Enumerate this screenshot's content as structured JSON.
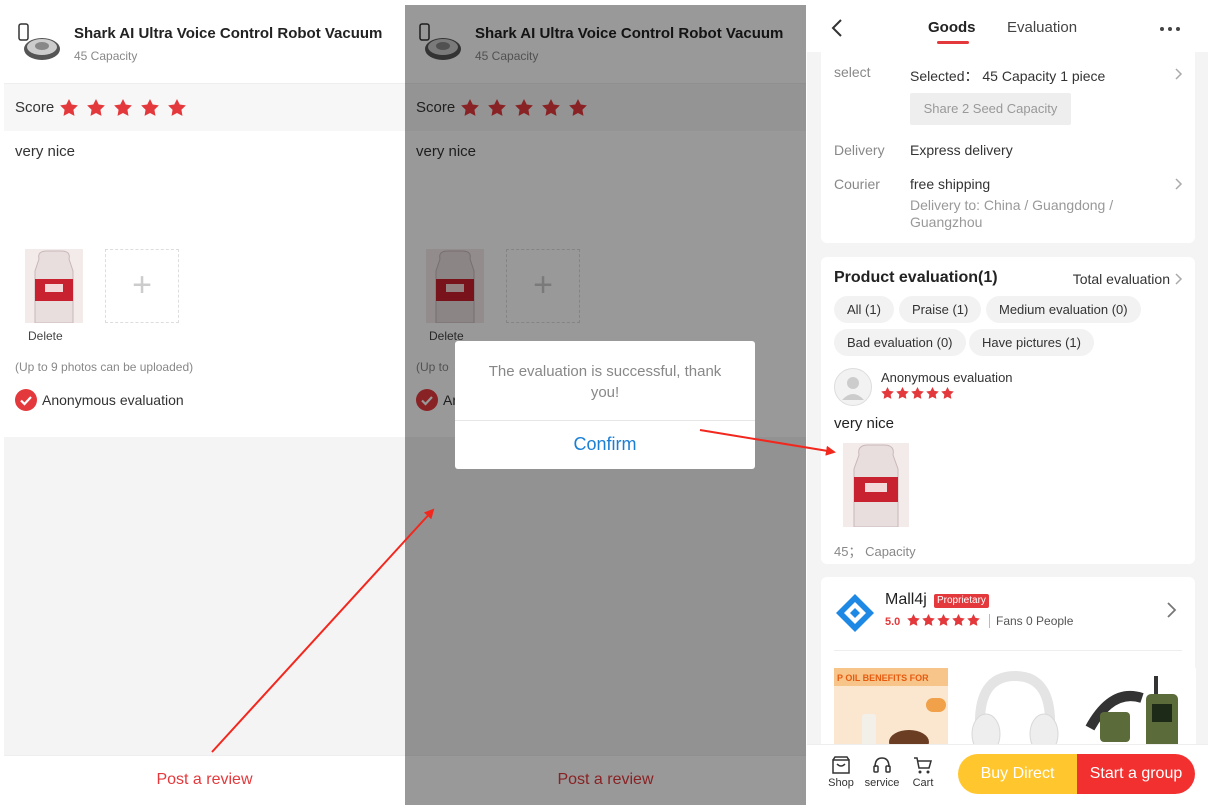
{
  "review": {
    "product_name": "Shark AI Ultra Voice Control Robot Vacuum",
    "product_spec": "45 Capacity",
    "score_label": "Score",
    "rating": 5,
    "review_text": "very nice",
    "delete_label": "Delete",
    "upload_limit": "(Up to 9 photos can be uploaded)",
    "anonymous_label": "Anonymous evaluation",
    "anonymous_checked": true,
    "anon_short": "An",
    "upload_short": "(Up to",
    "post_button": "Post a review"
  },
  "dialog": {
    "message": "The evaluation is successful, thank you!",
    "confirm": "Confirm"
  },
  "detail": {
    "nav": {
      "tab_goods": "Goods",
      "tab_evaluation": "Evaluation"
    },
    "select_label": "select",
    "selected_text": "Selected： 45 Capacity   1  piece",
    "seed_option": "Share 2 Seed Capacity",
    "delivery_label": "Delivery",
    "delivery_value": "Express delivery",
    "courier_label": "Courier",
    "courier_value": "free shipping",
    "delivery_to": "Delivery to: China / Guangdong / Guangzhou",
    "evaluation": {
      "title": "Product evaluation(1)",
      "total_link": "Total evaluation",
      "filters": [
        "All (1)",
        "Praise (1)",
        "Medium evaluation (0)",
        "Bad evaluation (0)",
        "Have pictures (1)"
      ],
      "user": "Anonymous evaluation",
      "rating": 5,
      "comment": "very nice",
      "spec": "45； Capacity"
    },
    "shop": {
      "name": "Mall4j",
      "badge": "Proprietary",
      "rating": "5.0",
      "fans_text": "Fans   0  People",
      "recommend_banner": "P OIL BENEFITS FOR"
    },
    "bottom": {
      "shop": "Shop",
      "service": "service",
      "cart": "Cart",
      "buy_direct": "Buy Direct",
      "start_group": "Start a group"
    }
  },
  "colors": {
    "accent": "#e4393c",
    "buy": "#ffc62e",
    "group": "#f23030",
    "link": "#1a7fd4"
  }
}
